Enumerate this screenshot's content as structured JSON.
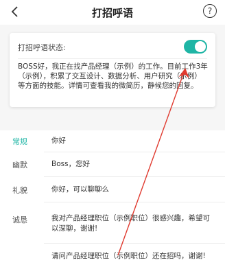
{
  "header": {
    "title": "打招呼语",
    "back_icon": "chevron-left-icon",
    "help_icon": "question-circle-icon",
    "help_glyph": "?"
  },
  "card": {
    "status_label": "打招呼语状态:",
    "toggle_on": true,
    "toggle_color": "#1fb5a5",
    "greeting": "BOSS好，我正在找产品经理（示例）的工作。目前工作3年（示例），积累了交互设计、数据分析、用户研究（示例）等方面的技能。详情可查看我的微简历，静候您的回复。"
  },
  "categories": [
    {
      "label": "常规",
      "active": true
    },
    {
      "label": "幽默",
      "active": false
    },
    {
      "label": "礼貌",
      "active": false
    },
    {
      "label": "诚恳",
      "active": false
    }
  ],
  "messages": [
    {
      "text": "你好"
    },
    {
      "text": "Boss，您好"
    },
    {
      "text": "你好，可以聊聊么"
    },
    {
      "text": "我对产品经理职位（示例职位）很感兴趣，希望可以深聊，谢谢!"
    },
    {
      "text": "请问产品经理职位（示例职位）还在招吗，谢谢!"
    }
  ],
  "colors": {
    "accent": "#1fb5a5",
    "annotation": "#e03a2f"
  }
}
